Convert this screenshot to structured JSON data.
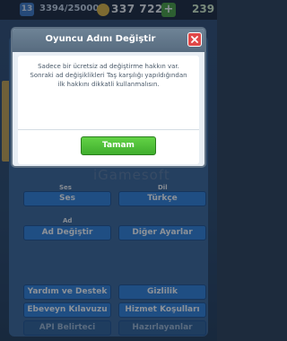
{
  "topbar": {
    "level": "13",
    "xp_progress": "3394/25000",
    "gold": "337 722",
    "gems": "239",
    "add_symbol": "+"
  },
  "background": {
    "watermark": "iGamesoft",
    "sections": {
      "ses_label": "Ses",
      "dil_label": "Dil",
      "ad_label": "Ad"
    },
    "buttons": {
      "sound": "Ses",
      "language": "Türkçe",
      "change_name": "Ad Değiştir",
      "other_settings": "Diğer Ayarlar",
      "help_support": "Yardım ve Destek",
      "privacy": "Gizlilik",
      "parent_guide": "Ebeveyn Kılavuzu",
      "terms": "Hizmet Koşulları",
      "api_token": "API Belirteci",
      "credits": "Hazırlayanlar"
    }
  },
  "dialog": {
    "title": "Oyuncu Adını Değiştir",
    "message": "Sadece bir ücretsiz ad değiştirme hakkın var. Sonraki ad değişiklikleri Taş karşılığı yapıldığından ilk hakkını dikkatli kullanmalısın.",
    "ok_label": "Tamam"
  },
  "colors": {
    "ok_green": "#4cbe34",
    "close_red": "#e04848",
    "header_slate": "#62778b",
    "button_blue": "#2f7fd6"
  }
}
